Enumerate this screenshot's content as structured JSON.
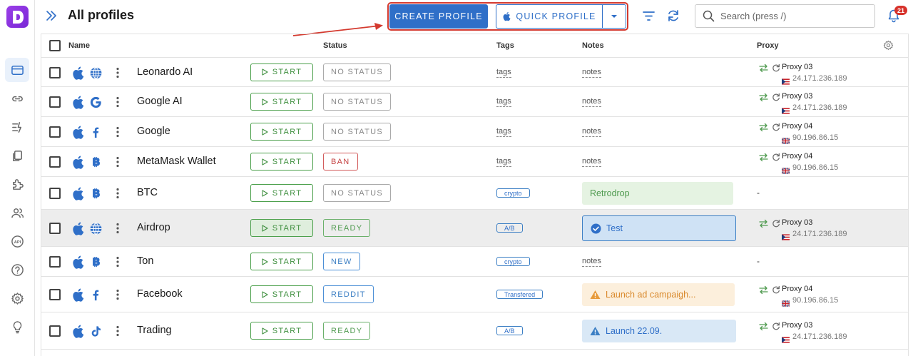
{
  "header": {
    "title": "All profiles",
    "create_label": "CREATE PROFILE",
    "quick_label": "QUICK PROFILE",
    "search_placeholder": "Search (press /)",
    "notifications_count": "21"
  },
  "sidebar": {
    "items": [
      "profiles-icon",
      "link-icon",
      "automation-icon",
      "copy-icon",
      "extensions-icon",
      "team-icon",
      "api-icon",
      "help-icon",
      "settings-icon",
      "idea-icon"
    ],
    "api_label": "API"
  },
  "table": {
    "columns": {
      "name": "Name",
      "status": "Status",
      "tags": "Tags",
      "notes": "Notes",
      "proxy": "Proxy"
    },
    "start_label": "START",
    "rows": [
      {
        "name": "Leonardo AI",
        "site_icon": "globe-icon",
        "status": "NO STATUS",
        "status_kind": "none",
        "tag": "tags",
        "tag_kind": "link",
        "note": "notes",
        "note_kind": "link",
        "proxy": {
          "name": "Proxy 03",
          "ip": "24.171.236.189",
          "flag": "pr"
        }
      },
      {
        "name": "Google AI",
        "site_icon": "google-icon",
        "status": "NO STATUS",
        "status_kind": "none",
        "tag": "tags",
        "tag_kind": "link",
        "note": "notes",
        "note_kind": "link",
        "proxy": {
          "name": "Proxy 03",
          "ip": "24.171.236.189",
          "flag": "pr"
        }
      },
      {
        "name": "Google",
        "site_icon": "facebook-icon",
        "status": "NO STATUS",
        "status_kind": "none",
        "tag": "tags",
        "tag_kind": "link",
        "note": "notes",
        "note_kind": "link",
        "proxy": {
          "name": "Proxy 04",
          "ip": "90.196.86.15",
          "flag": "uk"
        }
      },
      {
        "name": "MetaMask Wallet",
        "site_icon": "bitcoin-icon",
        "status": "BAN",
        "status_kind": "ban",
        "tag": "tags",
        "tag_kind": "link",
        "note": "notes",
        "note_kind": "link",
        "proxy": {
          "name": "Proxy 04",
          "ip": "90.196.86.15",
          "flag": "uk"
        }
      },
      {
        "name": "BTC",
        "site_icon": "bitcoin-icon",
        "status": "NO STATUS",
        "status_kind": "none",
        "tag": "crypto",
        "tag_kind": "chip",
        "note": "Retrodrop",
        "note_kind": "green",
        "proxy": null,
        "proxy_empty": "-"
      },
      {
        "name": "Airdrop",
        "site_icon": "globe-icon",
        "status": "READY",
        "status_kind": "ready",
        "tag": "A/B",
        "tag_kind": "chip",
        "note": "Test",
        "note_kind": "blue-sel",
        "proxy": {
          "name": "Proxy 03",
          "ip": "24.171.236.189",
          "flag": "pr"
        }
      },
      {
        "name": "Ton",
        "site_icon": "bitcoin-icon",
        "status": "NEW",
        "status_kind": "new",
        "tag": "crypto",
        "tag_kind": "chip",
        "note": "notes",
        "note_kind": "link",
        "proxy": null,
        "proxy_empty": "-"
      },
      {
        "name": "Facebook",
        "site_icon": "facebook-icon",
        "status": "REDDIT",
        "status_kind": "reddit",
        "tag": "Transfered",
        "tag_kind": "chip",
        "note": "Launch ad campaigh...",
        "note_kind": "orange",
        "proxy": {
          "name": "Proxy 04",
          "ip": "90.196.86.15",
          "flag": "uk"
        }
      },
      {
        "name": "Trading",
        "site_icon": "tiktok-icon",
        "status": "READY",
        "status_kind": "ready",
        "tag": "A/B",
        "tag_kind": "chip",
        "note": "Launch 22.09.",
        "note_kind": "blue",
        "proxy": {
          "name": "Proxy 03",
          "ip": "24.171.236.189",
          "flag": "pr"
        }
      }
    ]
  },
  "colors": {
    "accent": "#2f6fc8",
    "annotation": "#d43a2f",
    "start": "#4ca04c"
  }
}
